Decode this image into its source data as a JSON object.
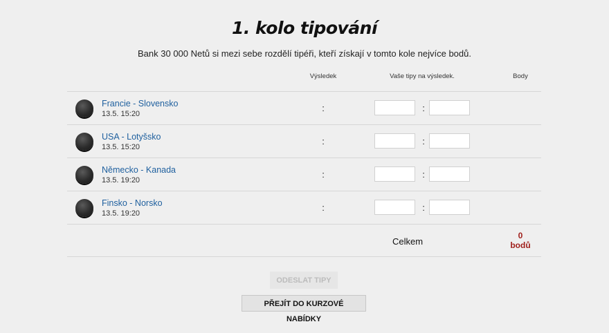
{
  "title": "1. kolo tipování",
  "subtitle": "Bank 30 000 Netů si mezi sebe rozdělí tipéři, kteří získají v tomto kole nejvíce bodů.",
  "headers": {
    "result": "Výsledek",
    "tips": "Vaše tipy na výsledek.",
    "points": "Body"
  },
  "matches": [
    {
      "teams": "Francie - Slovensko",
      "time": "13.5. 15:20",
      "result": ":",
      "tip_separator": ":"
    },
    {
      "teams": "USA - Lotyšsko",
      "time": "13.5. 15:20",
      "result": ":",
      "tip_separator": ":"
    },
    {
      "teams": "Německo - Kanada",
      "time": "13.5. 19:20",
      "result": ":",
      "tip_separator": ":"
    },
    {
      "teams": "Finsko - Norsko",
      "time": "13.5. 19:20",
      "result": ":",
      "tip_separator": ":"
    }
  ],
  "total": {
    "label": "Celkem",
    "points": "0",
    "points_unit": "bodů"
  },
  "buttons": {
    "send": "ODESLAT TIPY",
    "odds": "PŘEJÍT DO KURZOVÉ NABÍDKY"
  },
  "colors": {
    "background": "#efefef",
    "link": "#1e5f9e",
    "points": "#a0201c"
  }
}
